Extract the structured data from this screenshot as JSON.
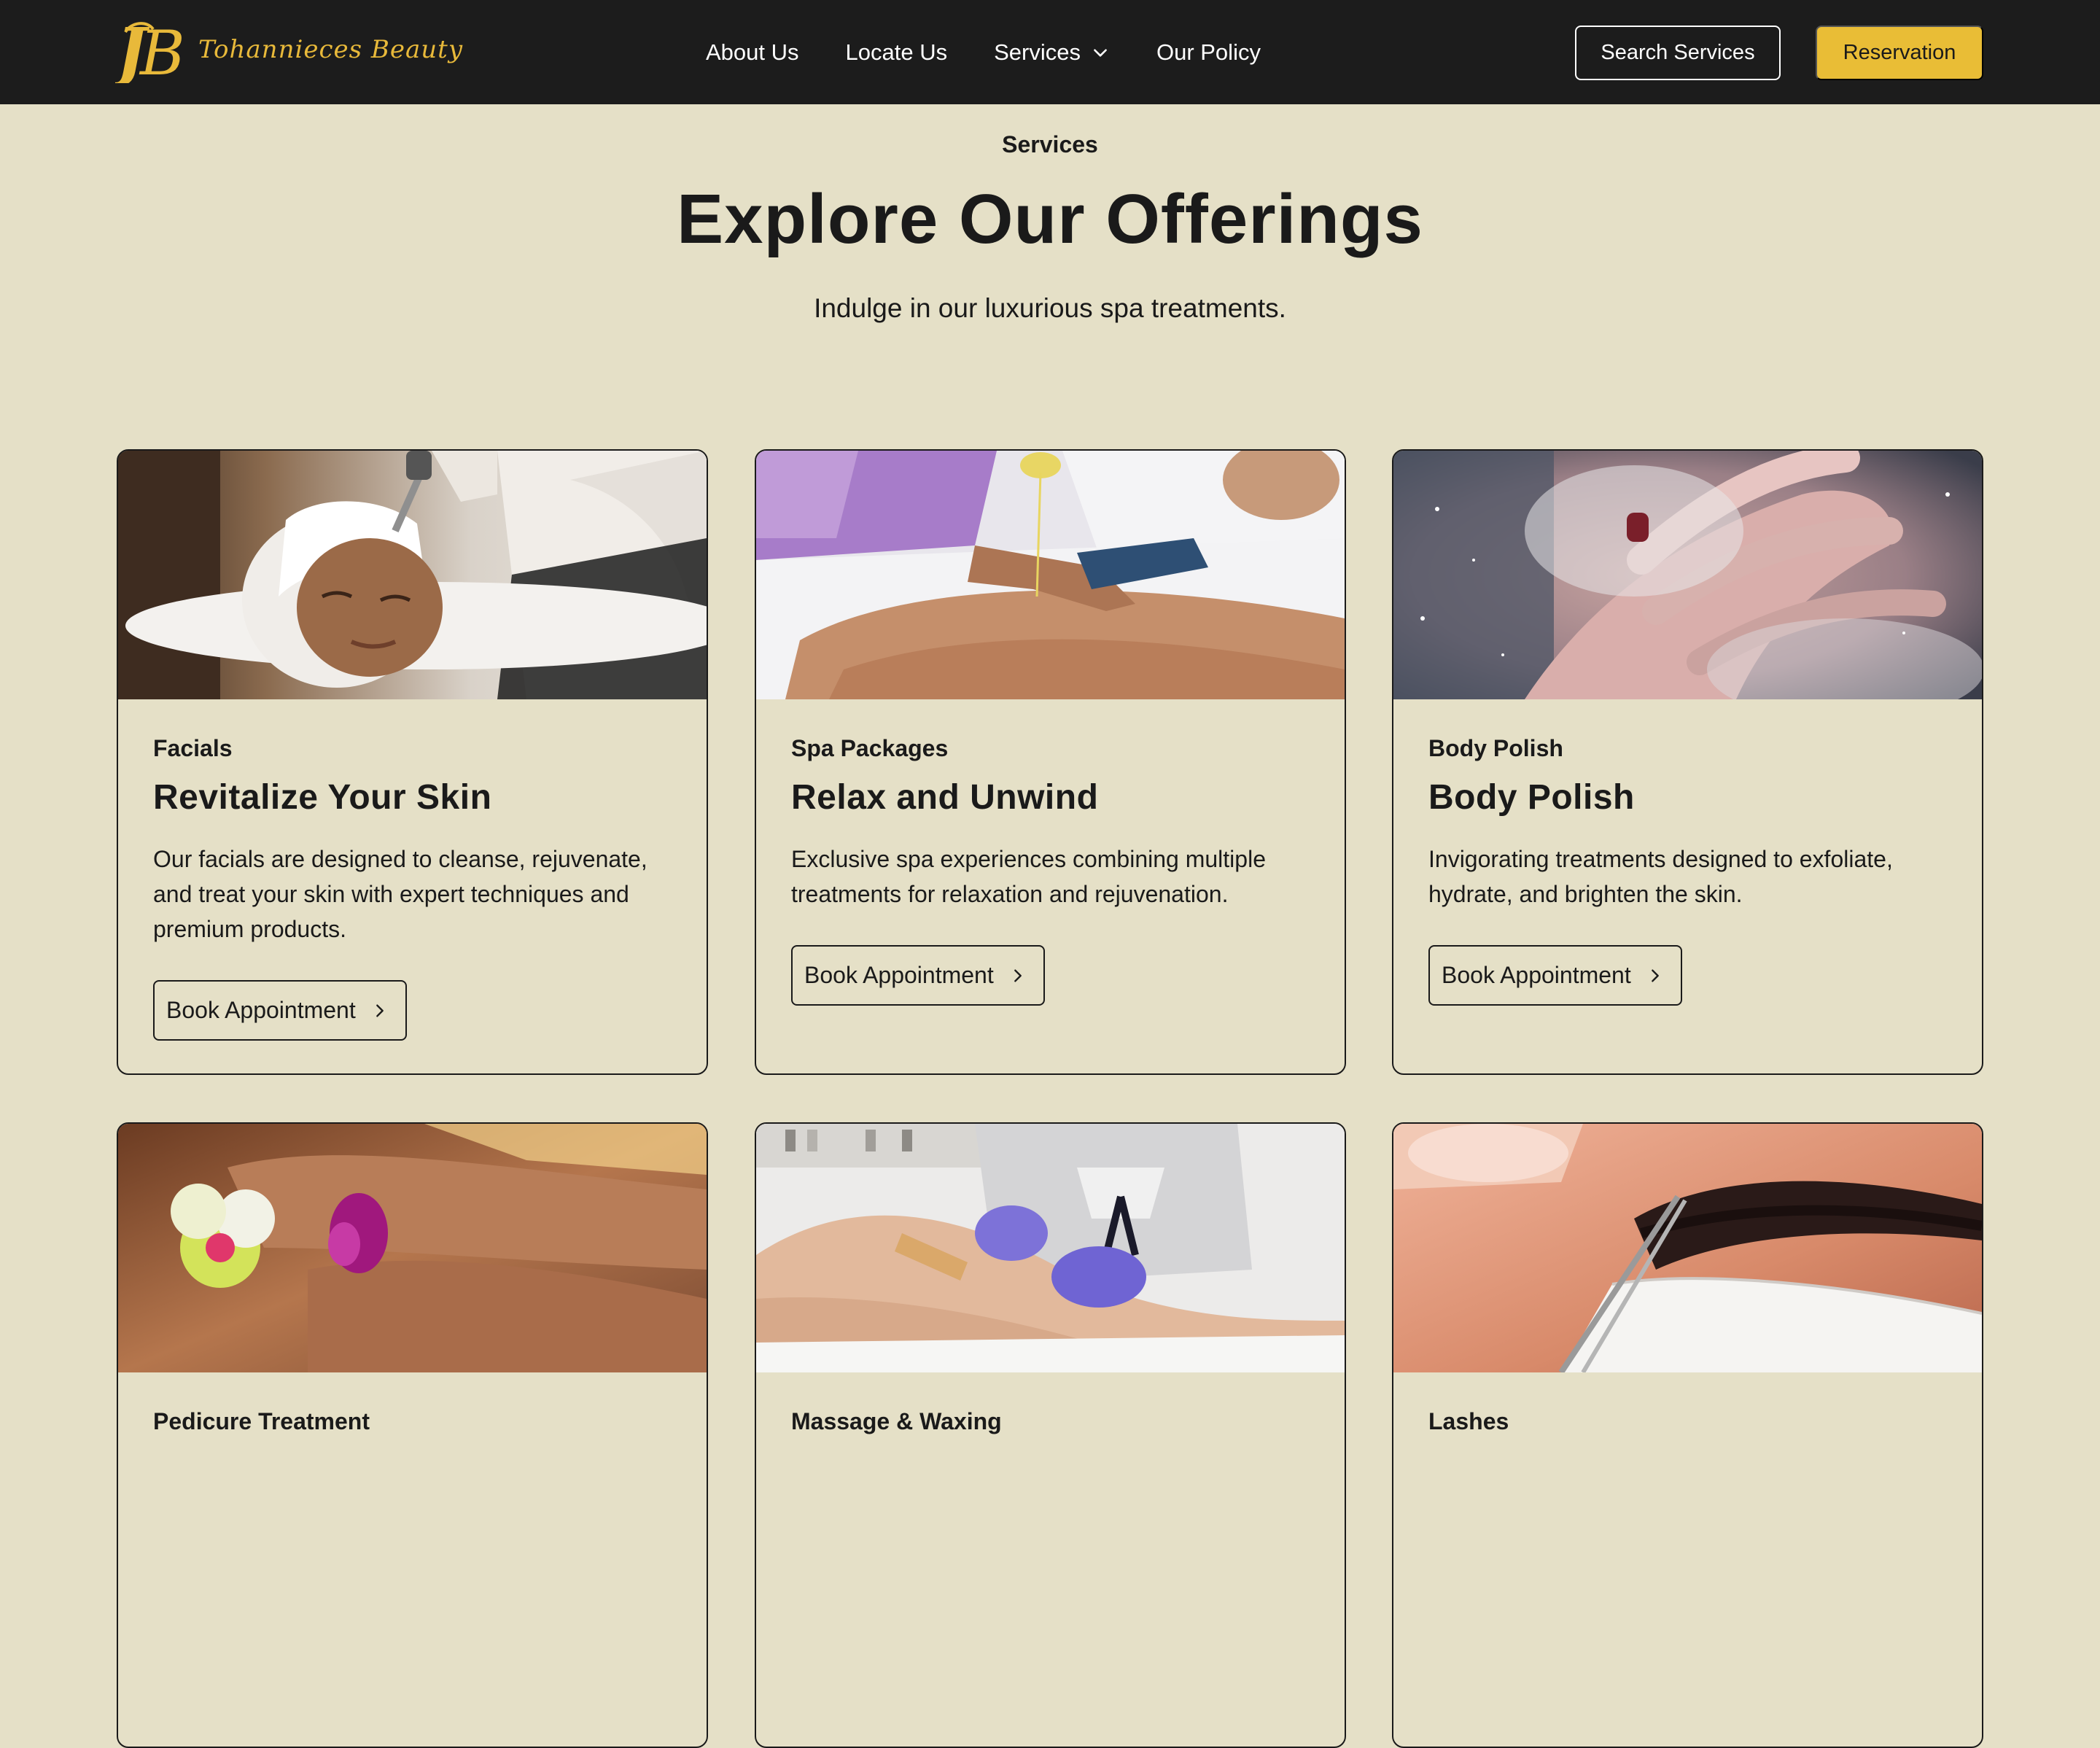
{
  "brand": {
    "name": "Tohannieces Beauty",
    "logo_letters": "JB",
    "accent": "#e9bd36"
  },
  "nav": {
    "links": [
      "About Us",
      "Locate Us",
      "Services",
      "Our Policy"
    ],
    "services_has_dropdown": true,
    "search_label": "Search Services",
    "reserve_label": "Reservation"
  },
  "hero": {
    "eyebrow": "Services",
    "title": "Explore Our Offerings",
    "subtitle": "Indulge in our luxurious spa treatments."
  },
  "cards": [
    {
      "category": "Facials",
      "title": "Revitalize Your Skin",
      "description": "Our facials are designed to cleanse, rejuvenate, and treat your skin with expert techniques and premium products.",
      "button": "Book Appointment",
      "image": "facial-treatment-photo"
    },
    {
      "category": "Spa Packages",
      "title": "Relax and Unwind",
      "description": "Exclusive spa experiences combining multiple treatments for relaxation and rejuvenation.",
      "button": "Book Appointment",
      "image": "oil-massage-photo"
    },
    {
      "category": "Body Polish",
      "title": "Body Polish",
      "description": "Invigorating treatments designed to exfoliate, hydrate, and brighten the skin.",
      "button": "Book Appointment",
      "image": "body-scrub-photo"
    },
    {
      "category": "Pedicure Treatment",
      "image": "pedicure-photo"
    },
    {
      "category": "Massage & Waxing",
      "image": "leg-waxing-photo"
    },
    {
      "category": "Lashes",
      "image": "lash-extension-photo"
    }
  ]
}
